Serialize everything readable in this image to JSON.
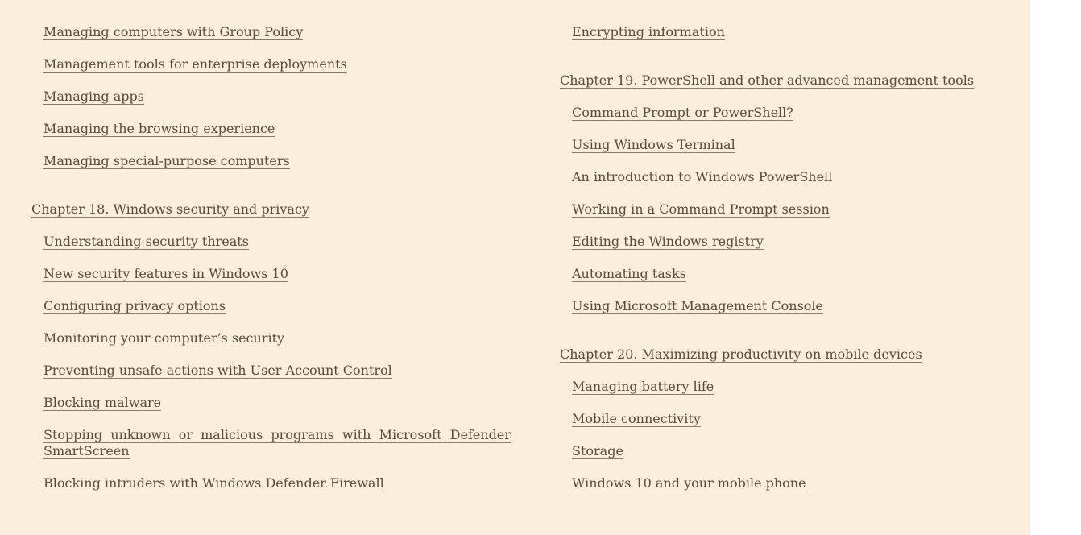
{
  "left_column": {
    "items": [
      {
        "label": "Managing computers with Group Policy"
      },
      {
        "label": "Management tools for enterprise deployments"
      },
      {
        "label": "Managing apps"
      },
      {
        "label": "Managing the browsing experience"
      },
      {
        "label": "Managing special-purpose computers"
      }
    ],
    "chapter18": {
      "title": "Chapter 18. Windows security and privacy",
      "items": [
        {
          "label": "Understanding security threats"
        },
        {
          "label": "New security features in Windows 10"
        },
        {
          "label": "Configuring privacy options"
        },
        {
          "label": "Monitoring your computer’s security"
        },
        {
          "label": "Preventing unsafe actions with User Account Control"
        },
        {
          "label": "Blocking malware"
        },
        {
          "label": "Stopping unknown or malicious programs with Microsoft Defender SmartScreen"
        },
        {
          "label": "Blocking intruders with Windows Defender Firewall"
        }
      ]
    }
  },
  "right_column": {
    "items": [
      {
        "label": "Encrypting information"
      }
    ],
    "chapter19": {
      "title": "Chapter 19. PowerShell and other advanced management tools",
      "items": [
        {
          "label": "Command Prompt or PowerShell?"
        },
        {
          "label": "Using Windows Terminal"
        },
        {
          "label": "An introduction to Windows PowerShell"
        },
        {
          "label": "Working in a Command Prompt session"
        },
        {
          "label": "Editing the Windows registry"
        },
        {
          "label": "Automating tasks"
        },
        {
          "label": "Using Microsoft Management Console"
        }
      ]
    },
    "chapter20": {
      "title": "Chapter 20. Maximizing productivity on mobile devices",
      "items": [
        {
          "label": "Managing battery life"
        },
        {
          "label": "Mobile connectivity"
        },
        {
          "label": "Storage"
        },
        {
          "label": "Windows 10 and your mobile phone"
        }
      ]
    }
  }
}
